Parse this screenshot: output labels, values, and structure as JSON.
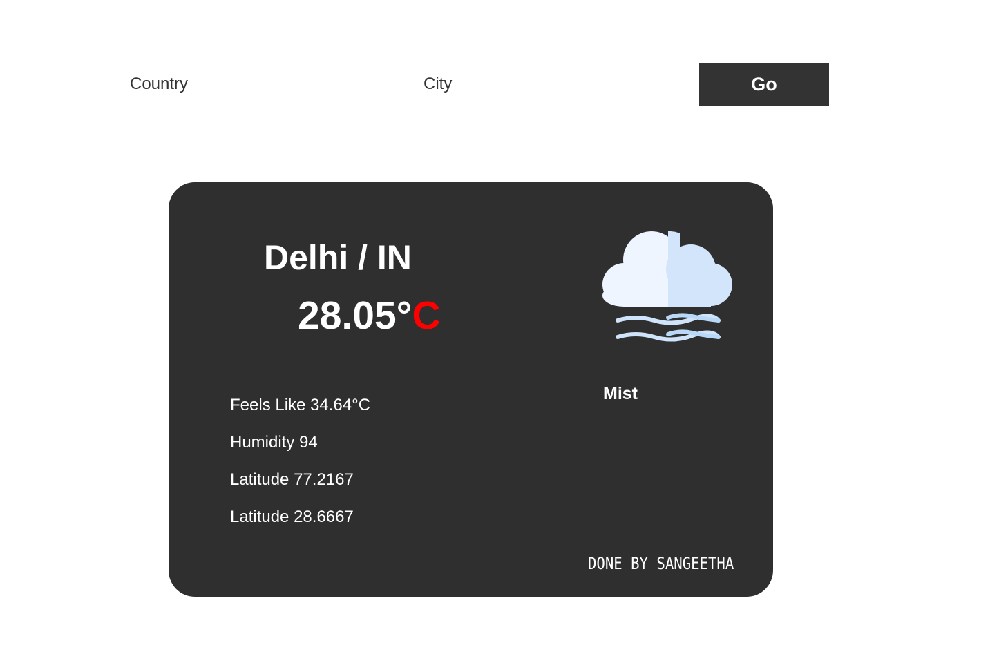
{
  "search": {
    "country_placeholder": "Country",
    "city_placeholder": "City",
    "go_label": "Go"
  },
  "weather": {
    "location": "Delhi / IN",
    "temperature_value": "28.05°",
    "temperature_unit": "C",
    "condition": "Mist",
    "icon": "mist-cloud-icon",
    "details": {
      "feels_like": "Feels Like 34.64°C",
      "humidity": "Humidity 94",
      "latitude_1": "Latitude 77.2167",
      "latitude_2": "Latitude 28.6667"
    }
  },
  "footer": {
    "credit": "DONE BY SANGEETHA"
  },
  "colors": {
    "card_background": "#2f2f2f",
    "button_background": "#333333",
    "unit_accent": "#ff0000",
    "cloud_light": "#eef5ff",
    "cloud_shade": "#d3e5fb",
    "wave_color": "#b9d8f7"
  }
}
